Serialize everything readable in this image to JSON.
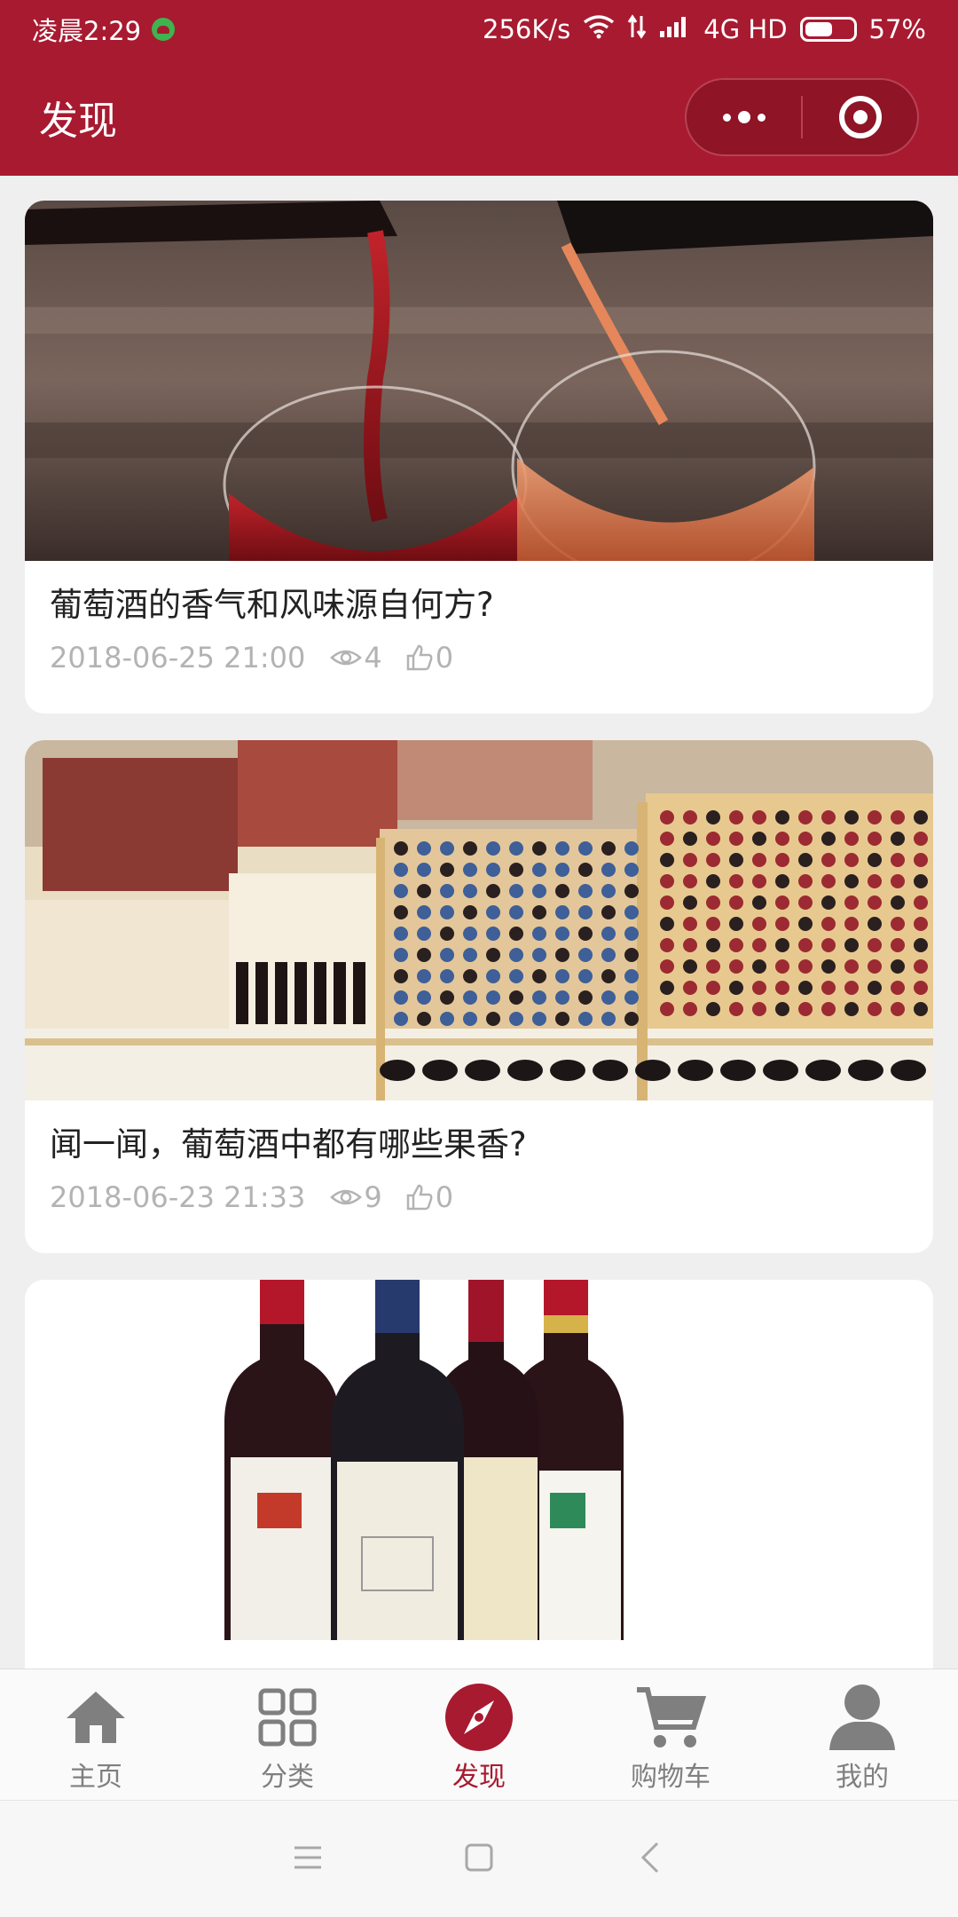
{
  "status_bar": {
    "time": "凌晨2:29",
    "net_speed": "256K/s",
    "network": "4G HD",
    "battery_percent": "57%",
    "battery_level": 0.57
  },
  "header": {
    "title": "发现"
  },
  "articles": [
    {
      "title": "葡萄酒的香气和风味源自何方?",
      "date": "2018-06-25 21:00",
      "views": "4",
      "likes": "0"
    },
    {
      "title": "闻一闻，葡萄酒中都有哪些果香?",
      "date": "2018-06-23 21:33",
      "views": "9",
      "likes": "0"
    },
    {
      "title": "",
      "date": "",
      "views": "",
      "likes": ""
    }
  ],
  "tab_bar": {
    "items": [
      {
        "label": "主页",
        "icon": "home-icon"
      },
      {
        "label": "分类",
        "icon": "grid-icon"
      },
      {
        "label": "发现",
        "icon": "compass-icon",
        "active": true
      },
      {
        "label": "购物车",
        "icon": "cart-icon"
      },
      {
        "label": "我的",
        "icon": "user-icon"
      }
    ]
  },
  "theme": {
    "accent": "#a81a30",
    "inactive": "#7f7f7f"
  }
}
